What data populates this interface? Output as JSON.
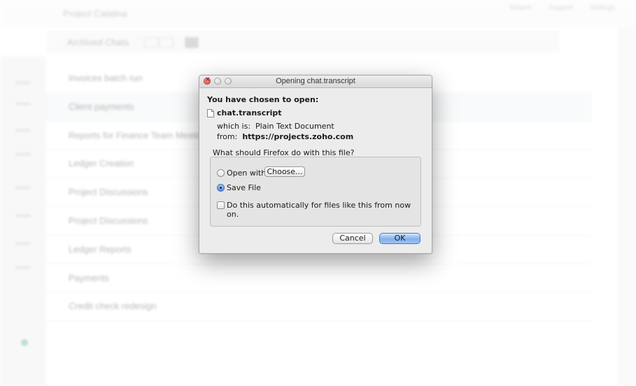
{
  "background": {
    "project_title": "Project Catalina",
    "top_links": [
      "Search",
      "Support",
      "Settings"
    ],
    "archived_label": "Archived Chats",
    "items": [
      {
        "label": "Invoices batch run"
      },
      {
        "label": "Client payments"
      },
      {
        "label": "Reports for Finance Team Meeting"
      },
      {
        "label": "Ledger Creation"
      },
      {
        "label": "Project Discussions"
      },
      {
        "label": "Project Discussions"
      },
      {
        "label": "Ledger Reports"
      },
      {
        "label": "Payments"
      },
      {
        "label": "Credit check redesign"
      }
    ]
  },
  "dialog": {
    "title": "Opening chat.transcript",
    "chosen_label": "You have chosen to open:",
    "file_name": "chat.transcript",
    "which_is_prefix": "which is:",
    "which_is_value": "Plain Text Document",
    "from_prefix": "from:",
    "from_value": "https://projects.zoho.com",
    "question": "What should Firefox do with this file?",
    "open_with_label": "Open with",
    "choose_label": "Choose...",
    "save_file_label": "Save File",
    "selected_option": "Save File",
    "auto_label": "Do this automatically for files like this from now on.",
    "auto_checked": false,
    "cancel_label": "Cancel",
    "ok_label": "OK"
  },
  "colors": {
    "ok_button": "#80b1ee",
    "close_button": "#d9463f",
    "dialog_bg": "#ececec"
  }
}
